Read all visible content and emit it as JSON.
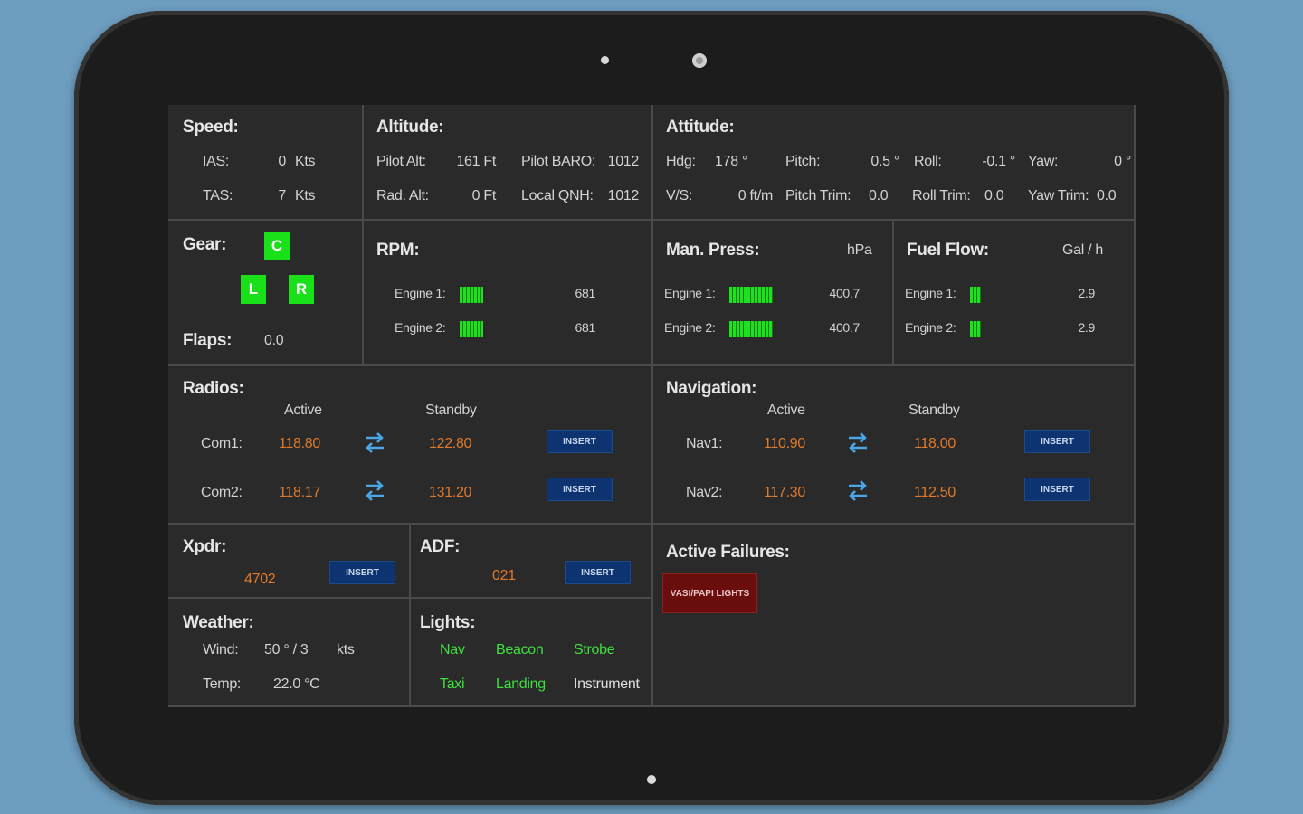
{
  "speed": {
    "title": "Speed:",
    "ias_label": "IAS:",
    "ias_value": "0",
    "ias_unit": "Kts",
    "tas_label": "TAS:",
    "tas_value": "7",
    "tas_unit": "Kts"
  },
  "altitude": {
    "title": "Altitude:",
    "pilot_alt_label": "Pilot Alt:",
    "pilot_alt_value": "161 Ft",
    "pilot_baro_label": "Pilot BARO:",
    "pilot_baro_value": "1012",
    "rad_alt_label": "Rad. Alt:",
    "rad_alt_value": "0 Ft",
    "local_qnh_label": "Local QNH:",
    "local_qnh_value": "1012"
  },
  "attitude": {
    "title": "Attitude:",
    "hdg_label": "Hdg:",
    "hdg_value": "178 °",
    "pitch_label": "Pitch:",
    "pitch_value": "0.5 °",
    "roll_label": "Roll:",
    "roll_value": "-0.1 °",
    "yaw_label": "Yaw:",
    "yaw_value": "0 °",
    "vs_label": "V/S:",
    "vs_value": "0 ft/m",
    "pitch_trim_label": "Pitch Trim:",
    "pitch_trim_value": "0.0",
    "roll_trim_label": "Roll Trim:",
    "roll_trim_value": "0.0",
    "yaw_trim_label": "Yaw Trim:",
    "yaw_trim_value": "0.0"
  },
  "gear": {
    "title": "Gear:",
    "center": "C",
    "left": "L",
    "right": "R",
    "flaps_label": "Flaps:",
    "flaps_value": "0.0"
  },
  "rpm": {
    "title": "RPM:",
    "engine1_label": "Engine 1:",
    "engine1_value": "681",
    "engine2_label": "Engine 2:",
    "engine2_value": "681"
  },
  "man_press": {
    "title": "Man. Press:",
    "unit": "hPa",
    "engine1_label": "Engine 1:",
    "engine1_value": "400.7",
    "engine2_label": "Engine 2:",
    "engine2_value": "400.7"
  },
  "fuel_flow": {
    "title": "Fuel Flow:",
    "unit": "Gal / h",
    "engine1_label": "Engine 1:",
    "engine1_value": "2.9",
    "engine2_label": "Engine 2:",
    "engine2_value": "2.9"
  },
  "radios": {
    "title": "Radios:",
    "active_header": "Active",
    "standby_header": "Standby",
    "com1_label": "Com1:",
    "com1_active": "118.80",
    "com1_standby": "122.80",
    "com2_label": "Com2:",
    "com2_active": "118.17",
    "com2_standby": "131.20",
    "insert_label": "INSERT"
  },
  "navigation": {
    "title": "Navigation:",
    "active_header": "Active",
    "standby_header": "Standby",
    "nav1_label": "Nav1:",
    "nav1_active": "110.90",
    "nav1_standby": "118.00",
    "nav2_label": "Nav2:",
    "nav2_active": "117.30",
    "nav2_standby": "112.50",
    "insert_label": "INSERT"
  },
  "xpdr": {
    "title": "Xpdr:",
    "value": "4702",
    "insert_label": "INSERT"
  },
  "adf": {
    "title": "ADF:",
    "value": "021",
    "insert_label": "INSERT"
  },
  "failures": {
    "title": "Active Failures:",
    "item": "VASI/PAPI LIGHTS"
  },
  "weather": {
    "title": "Weather:",
    "wind_label": "Wind:",
    "wind_value": "50 ° / 3",
    "wind_unit": "kts",
    "temp_label": "Temp:",
    "temp_value": "22.0 °C"
  },
  "lights": {
    "title": "Lights:",
    "nav": "Nav",
    "beacon": "Beacon",
    "strobe": "Strobe",
    "taxi": "Taxi",
    "landing": "Landing",
    "instrument": "Instrument"
  },
  "colors": {
    "background": "#6d9dbf",
    "active_freq": "#e07a2a",
    "light_on": "#3ee03e",
    "gear_down": "#19e019",
    "insert_button": "#0d3470",
    "failure": "#6a0d0d"
  }
}
